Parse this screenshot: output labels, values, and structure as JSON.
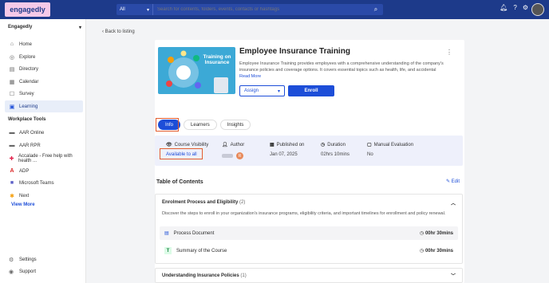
{
  "topbar": {
    "logo": "engagedly",
    "search_scope": "All",
    "search_placeholder": "Search for contents, folders, events, contacts or hashtags",
    "icons": [
      "bell-icon",
      "help-icon",
      "gear-icon"
    ],
    "accent": "#1d3a8a"
  },
  "sidebar": {
    "org": "Engagedly",
    "items": [
      {
        "label": "Home",
        "icon": "home-icon"
      },
      {
        "label": "Explore",
        "icon": "compass-icon"
      },
      {
        "label": "Directory",
        "icon": "directory-icon"
      },
      {
        "label": "Calendar",
        "icon": "calendar-icon"
      },
      {
        "label": "Survey",
        "icon": "survey-icon"
      },
      {
        "label": "Learning",
        "icon": "learning-icon",
        "active": true
      }
    ],
    "workplace_label": "Workplace Tools",
    "tools": [
      {
        "label": "AAR Online"
      },
      {
        "label": "AAR RPR"
      },
      {
        "label": "Accalade - Free help with health ..."
      },
      {
        "label": "ADP"
      },
      {
        "label": "Microsoft Teams"
      },
      {
        "label": "Next"
      }
    ],
    "view_more": "View More",
    "settings": "Settings",
    "support": "Support"
  },
  "main": {
    "back": "Back to listing",
    "course": {
      "thumb_text": "Training on Insurance",
      "title": "Employee Insurance Training",
      "description": "Employee Insurance Training provides employees with a comprehensive understanding of the company's insurance policies and coverage options. It covers essential topics such as health, life, and accidental insurance; claim processe...",
      "read_more": "Read More",
      "assign": "Assign",
      "enroll": "Enroll"
    },
    "tabs": [
      "Info",
      "Learners",
      "Insights"
    ],
    "meta": {
      "visibility_label": "Course Visibility",
      "visibility_value": "Available to all",
      "author_label": "Author",
      "author_initial": "R",
      "published_label": "Published on",
      "published_value": "Jan 07, 2025",
      "duration_label": "Duration",
      "duration_value": "02hrs 10mins",
      "manual_label": "Manual Evaluation",
      "manual_value": "No"
    },
    "toc": {
      "title": "Table of Contents",
      "edit": "Edit",
      "sections": [
        {
          "title": "Enrolment Process and Eligibility",
          "count": "(2)",
          "description": "Discover the steps to enroll in your organization's insurance programs, eligibility criteria, and important timelines for enrollment and policy renewal.",
          "items": [
            {
              "label": "Process Document",
              "duration": "00hr 30mins"
            },
            {
              "label": "Summary of the Course",
              "duration": "00hr 30mins"
            }
          ]
        },
        {
          "title": "Understanding Insurance Policies",
          "count": "(1)"
        }
      ]
    }
  }
}
